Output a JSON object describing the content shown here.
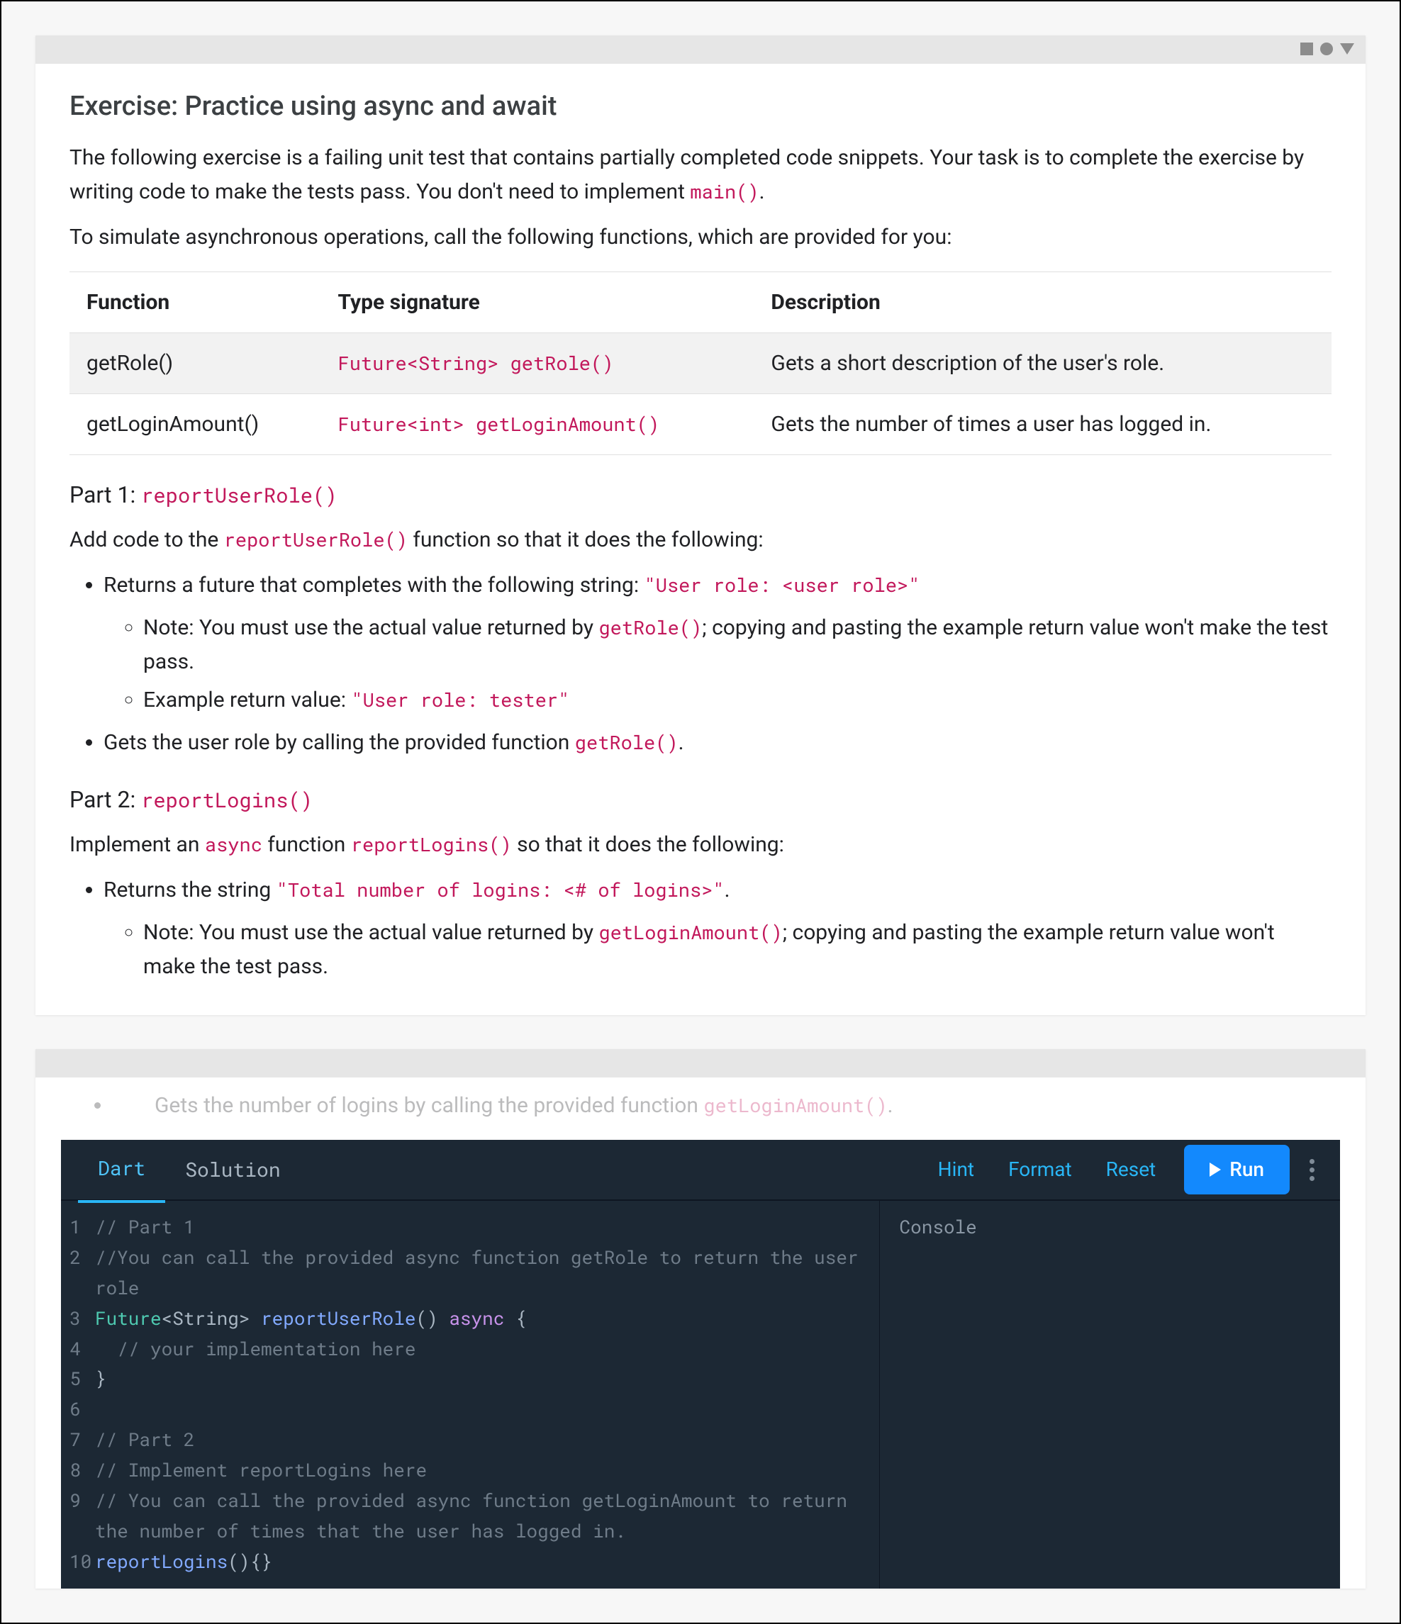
{
  "card1": {
    "title": "Exercise: Practice using async and await",
    "intro_a": "The following exercise is a failing unit test that contains partially completed code snippets. Your task is to complete the exercise by writing code to make the tests pass. You don't need to implement ",
    "intro_code": "main()",
    "intro_b": ".",
    "sim": "To simulate asynchronous operations, call the following functions, which are provided for you:",
    "table": {
      "h1": "Function",
      "h2": "Type signature",
      "h3": "Description",
      "r1c1": "getRole()",
      "r1c2": "Future<String> getRole()",
      "r1c3": "Gets a short description of the user's role.",
      "r2c1": "getLoginAmount()",
      "r2c2": "Future<int> getLoginAmount()",
      "r2c3": "Gets the number of times a user has logged in."
    },
    "p1_title_a": "Part 1: ",
    "p1_title_code": "reportUserRole()",
    "p1_a": "Add code to the ",
    "p1_code": "reportUserRole()",
    "p1_b": " function so that it does the following:",
    "p1_li1_a": "Returns a future that completes with the following string: ",
    "p1_li1_code": "\"User role: <user role>\"",
    "p1_li1a_a": "Note: You must use the actual value returned by ",
    "p1_li1a_code": "getRole()",
    "p1_li1a_b": "; copying and pasting the example return value won't make the test pass.",
    "p1_li1b_a": "Example return value: ",
    "p1_li1b_code": "\"User role: tester\"",
    "p1_li2_a": "Gets the user role by calling the provided function ",
    "p1_li2_code": "getRole()",
    "p1_li2_b": ".",
    "p2_title_a": "Part 2: ",
    "p2_title_code": "reportLogins()",
    "p2_a": "Implement an ",
    "p2_code1": "async",
    "p2_b": " function ",
    "p2_code2": "reportLogins()",
    "p2_c": " so that it does the following:",
    "p2_li1_a": "Returns the string ",
    "p2_li1_code": "\"Total number of logins: <# of logins>\"",
    "p2_li1_b": ".",
    "p2_li1a_a": "Note: You must use the actual value returned by ",
    "p2_li1a_code": "getLoginAmount()",
    "p2_li1a_b": "; copying and pasting the example return value won't make the test pass."
  },
  "card2": {
    "fade_a": "Gets the number of logins by calling the provided function ",
    "fade_code": "getLoginAmount()",
    "fade_b": ".",
    "tabs": {
      "dart": "Dart",
      "solution": "Solution"
    },
    "actions": {
      "hint": "Hint",
      "format": "Format",
      "reset": "Reset",
      "run": "Run"
    },
    "console": "Console",
    "code": {
      "l1": "// Part 1",
      "l2": "//You can call the provided async function getRole to return the user role",
      "l3_t": "Future",
      "l3_g": "<String>",
      "l3_fn": " reportUserRole",
      "l3_p": "() ",
      "l3_kw": "async",
      "l3_b": " {",
      "l4": "  // your implementation here",
      "l5": "}",
      "l6": "",
      "l7": "// Part 2",
      "l8": "// Implement reportLogins here",
      "l9": "// You can call the provided async function getLoginAmount to return the number of times that the user has logged in.",
      "l10_fn": "reportLogins",
      "l10_b": "(){}"
    }
  }
}
